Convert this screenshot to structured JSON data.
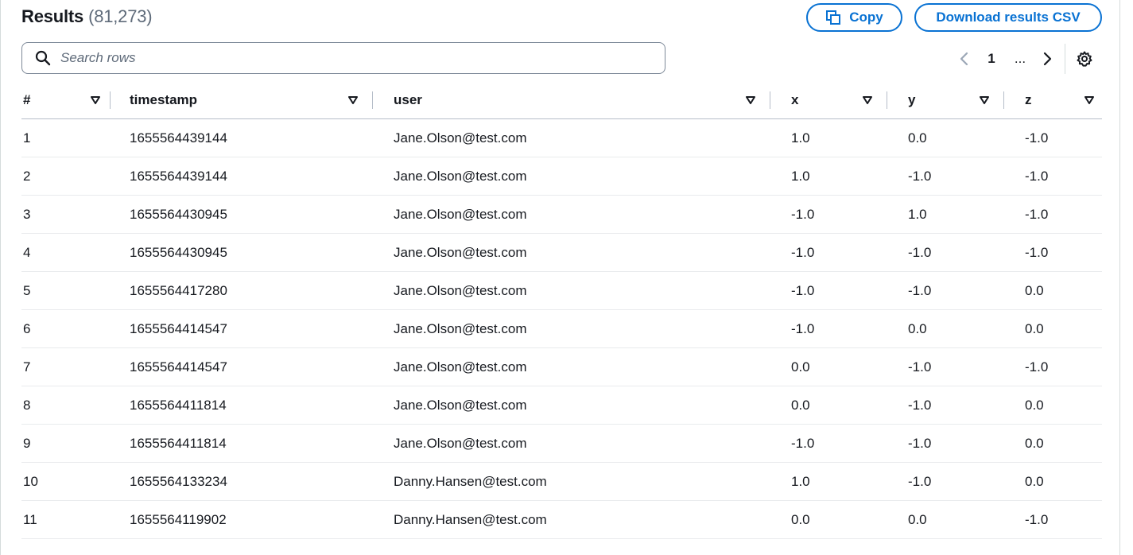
{
  "header": {
    "title": "Results",
    "count": "(81,273)",
    "copy_label": "Copy",
    "download_label": "Download results CSV"
  },
  "search": {
    "placeholder": "Search rows",
    "value": ""
  },
  "pagination": {
    "current_page": "1",
    "ellipsis": "..."
  },
  "table": {
    "columns": [
      "#",
      "timestamp",
      "user",
      "x",
      "y",
      "z"
    ],
    "rows": [
      [
        "1",
        "1655564439144",
        "Jane.Olson@test.com",
        "1.0",
        "0.0",
        "-1.0"
      ],
      [
        "2",
        "1655564439144",
        "Jane.Olson@test.com",
        "1.0",
        "-1.0",
        "-1.0"
      ],
      [
        "3",
        "1655564430945",
        "Jane.Olson@test.com",
        "-1.0",
        "1.0",
        "-1.0"
      ],
      [
        "4",
        "1655564430945",
        "Jane.Olson@test.com",
        "-1.0",
        "-1.0",
        "-1.0"
      ],
      [
        "5",
        "1655564417280",
        "Jane.Olson@test.com",
        "-1.0",
        "-1.0",
        "0.0"
      ],
      [
        "6",
        "1655564414547",
        "Jane.Olson@test.com",
        "-1.0",
        "0.0",
        "0.0"
      ],
      [
        "7",
        "1655564414547",
        "Jane.Olson@test.com",
        "0.0",
        "-1.0",
        "-1.0"
      ],
      [
        "8",
        "1655564411814",
        "Jane.Olson@test.com",
        "0.0",
        "-1.0",
        "0.0"
      ],
      [
        "9",
        "1655564411814",
        "Jane.Olson@test.com",
        "-1.0",
        "-1.0",
        "0.0"
      ],
      [
        "10",
        "1655564133234",
        "Danny.Hansen@test.com",
        "1.0",
        "-1.0",
        "0.0"
      ],
      [
        "11",
        "1655564119902",
        "Danny.Hansen@test.com",
        "0.0",
        "0.0",
        "-1.0"
      ]
    ]
  },
  "colors": {
    "accent": "#0972d3",
    "text": "#16191f",
    "muted": "#5f6b7a",
    "border": "#7d8998"
  },
  "icons": {
    "copy": "copy-icon",
    "search": "search-icon",
    "prev": "chevron-left-icon",
    "next": "chevron-right-icon",
    "settings": "gear-icon",
    "sort": "caret-down-icon"
  }
}
